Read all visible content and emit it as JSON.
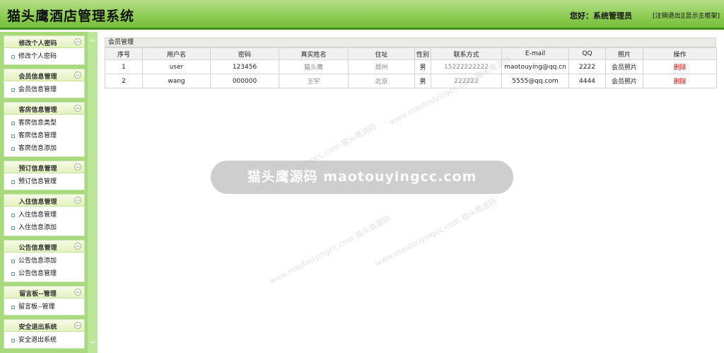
{
  "header": {
    "title": "猫头鹰酒店管理系统",
    "greeting": "您好：系统管理员",
    "logout_link": "[注销退出]",
    "show_frame_link": "[显示主框架]"
  },
  "sidebar": {
    "groups": [
      {
        "title": "修改个人密码",
        "items": [
          "修改个人密码"
        ]
      },
      {
        "title": "会员信息管理",
        "items": [
          "会员信息管理"
        ]
      },
      {
        "title": "客房信息管理",
        "items": [
          "客房信息类型",
          "客房信息管理",
          "客房信息添加"
        ]
      },
      {
        "title": "预订信息管理",
        "items": [
          "预订信息管理"
        ]
      },
      {
        "title": "入住信息管理",
        "items": [
          "入住信息管理",
          "入住信息添加"
        ]
      },
      {
        "title": "公告信息管理",
        "items": [
          "公告信息添加",
          "公告信息管理"
        ]
      },
      {
        "title": "留言板--管理",
        "items": [
          "留言板--管理"
        ]
      },
      {
        "title": "安全退出系统",
        "items": [
          "安全退出系统"
        ]
      }
    ]
  },
  "main": {
    "panel_title": "会员管理",
    "columns": [
      "序号",
      "用户名",
      "密码",
      "真实姓名",
      "住址",
      "性别",
      "联系方式",
      "E-mail",
      "QQ",
      "照片",
      "操作"
    ],
    "rows": [
      [
        "1",
        "user",
        "123456",
        "猫头鹰",
        "郑州",
        "男",
        "15222222222",
        "maotouying@qq.cn",
        "2222",
        "会员照片",
        "删除"
      ],
      [
        "2",
        "wang",
        "000000",
        "王宇",
        "北京",
        "男",
        "222222",
        "5555@qq.com",
        "4444",
        "会员照片",
        "删除"
      ]
    ]
  },
  "watermark": {
    "banner": "猫头鹰源码 maotouyingcc.com",
    "small": "www.maotouyingcc.com 猫头鹰源码"
  },
  "colors": {
    "header_green": "#8ccb52",
    "header_border": "#3f8f1f",
    "sidebar_green": "#a9d97e",
    "delete_red": "#e00000"
  }
}
